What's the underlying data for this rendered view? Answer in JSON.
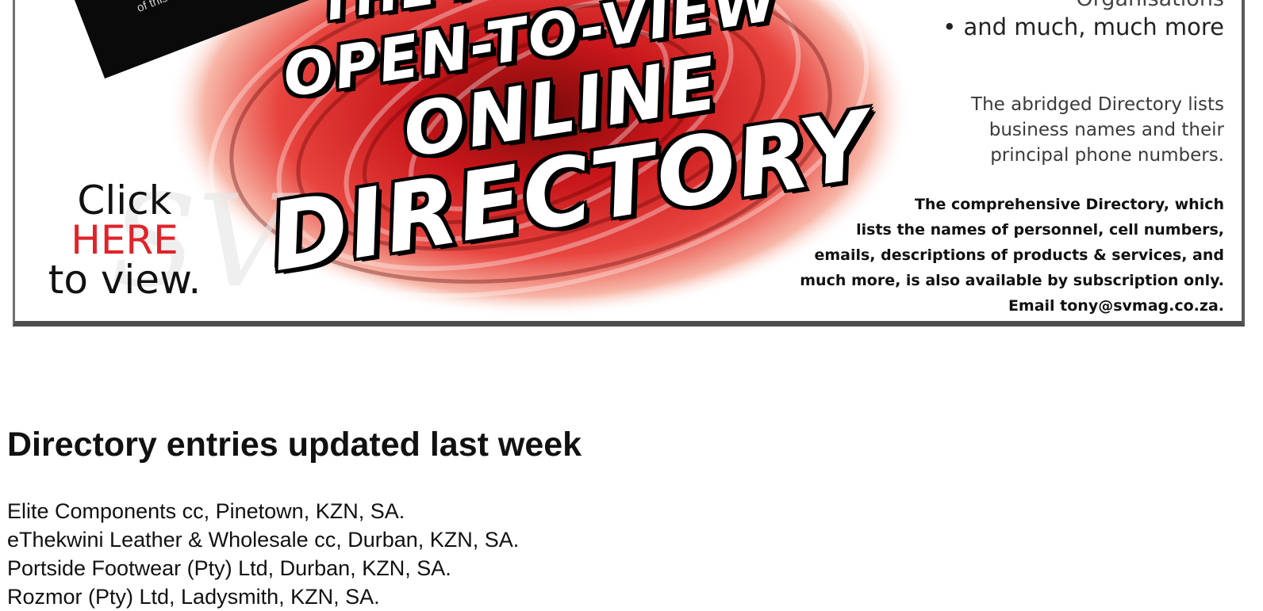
{
  "banner": {
    "flag_text": "The f\nof this Direc",
    "headline": {
      "line1": "THE ABR",
      "line2": "OPEN-TO-VIEW",
      "line3": "ONLINE",
      "line4": "DIRECTORY"
    },
    "click_line1": "Click",
    "click_line2": "HERE",
    "click_line3": "to view.",
    "bullet_partial": "Organisations",
    "bullet_more": "• and much, much more",
    "abridged_desc": [
      "The abridged Directory lists",
      "business names and their",
      "principal phone numbers."
    ],
    "full_desc": [
      "The comprehensive Directory, which",
      "lists the names of personnel, cell numbers,",
      "emails, descriptions of products & services, and",
      "much more, is also available by subscription only.",
      "Email tony@svmag.co.za."
    ],
    "colors": {
      "accent_red": "#e0232a",
      "swirl_red": "#d8141a",
      "black": "#0a0a0a"
    }
  },
  "section": {
    "title": "Directory entries updated last week",
    "entries": [
      "Elite Components cc, Pinetown, KZN, SA.",
      "eThekwini Leather & Wholesale cc, Durban, KZN, SA.",
      "Portside Footwear (Pty) Ltd, Durban, KZN, SA.",
      "Rozmor (Pty) Ltd, Ladysmith, KZN, SA."
    ]
  }
}
